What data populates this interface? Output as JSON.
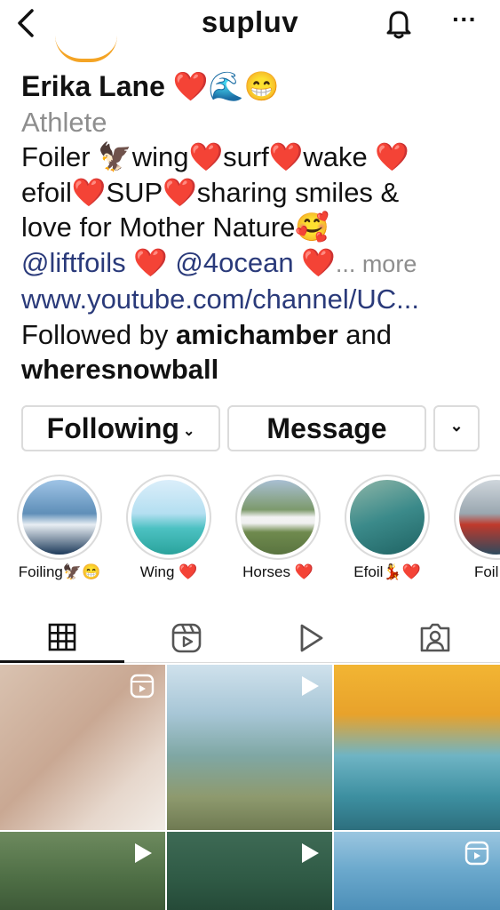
{
  "header": {
    "handle": "supluv"
  },
  "profile": {
    "name": "Erika Lane ❤️🌊😁",
    "category": "Athlete",
    "bio_lines": [
      "Foiler  🦅wing❤️surf❤️wake ❤️",
      "efoil❤️SUP❤️sharing smiles &",
      "love for Mother Nature🥰"
    ],
    "mentions": "@liftfoils ❤️ @4ocean ❤️",
    "more_label": "... more",
    "website": "www.youtube.com/channel/UC...",
    "followed_by_prefix": "Followed by ",
    "followed_by_user1": "amichamber",
    "followed_by_and": " and",
    "followed_by_user2": "wheresnowball"
  },
  "actions": {
    "following_label": "Following",
    "following_chevron": "⌄",
    "message_label": "Message",
    "dropdown_chevron": "⌄"
  },
  "highlights": [
    {
      "label": "Foiling🦅😁"
    },
    {
      "label": "Wing ❤️"
    },
    {
      "label": "Horses ❤️"
    },
    {
      "label": "Efoil💃❤️"
    },
    {
      "label": "Foil fai"
    }
  ],
  "tabs": [
    {
      "icon": "grid-icon",
      "active": true
    },
    {
      "icon": "reels-icon",
      "active": false
    },
    {
      "icon": "play-icon",
      "active": false
    },
    {
      "icon": "tagged-icon",
      "active": false
    }
  ],
  "posts": [
    {
      "type": "reel"
    },
    {
      "type": "video"
    },
    {
      "type": "photo"
    },
    {
      "type": "video"
    },
    {
      "type": "video"
    },
    {
      "type": "reel"
    }
  ],
  "colors": {
    "link": "#2a3a7a",
    "muted": "#8e8e8e",
    "border": "#dbdbdb",
    "story_arc": "#f4a425"
  }
}
